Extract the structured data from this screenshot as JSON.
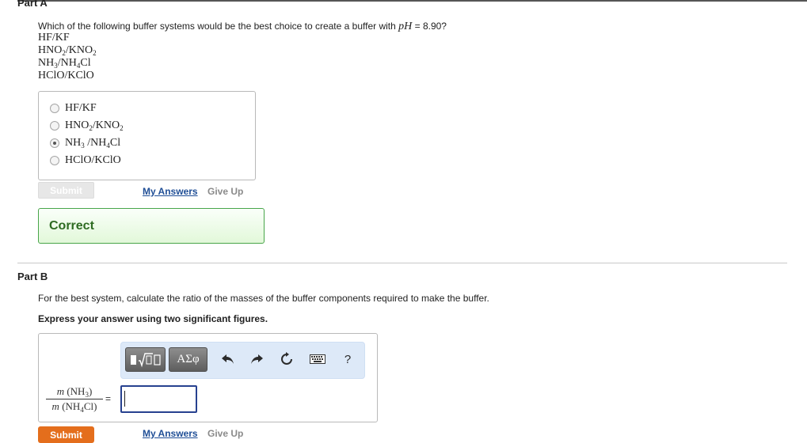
{
  "part_a": {
    "title": "Part A",
    "question_prefix": "Which of the following buffer systems would be the best choice to create a buffer with ",
    "question_ph": "pH",
    "question_suffix": " = 8.90?",
    "formulas": [
      {
        "a": "HF",
        "b": "KF"
      },
      {
        "a": "HNO",
        "a_sub": "2",
        "b": "KNO",
        "b_sub": "2"
      },
      {
        "a": "NH",
        "a_sub": "3",
        "b": "NH",
        "b_sub": "4",
        "b_tail": "Cl"
      },
      {
        "a": "HClO",
        "b": "KClO"
      }
    ],
    "choices": [
      {
        "id": "hf-kf",
        "selected": false
      },
      {
        "id": "hno2-kno2",
        "selected": false
      },
      {
        "id": "nh3-nh4cl",
        "selected": true
      },
      {
        "id": "hclo-kclo",
        "selected": false
      }
    ],
    "submit_label": "Submit",
    "my_answers_label": "My Answers",
    "give_up_label": "Give Up",
    "feedback": "Correct"
  },
  "part_b": {
    "title": "Part B",
    "question": "For the best system, calculate the ratio of the masses of the buffer components required to make the buffer.",
    "instruction": "Express your answer using two significant figures.",
    "toolbar": {
      "templates_icon": "templates-icon",
      "greek_label": "ΑΣφ",
      "undo_icon": "undo-icon",
      "redo_icon": "redo-icon",
      "reset_icon": "reset-icon",
      "keyboard_icon": "keyboard-icon",
      "help_label": "?"
    },
    "fraction_numerator_m": "m",
    "fraction_numerator_formula": "NH",
    "fraction_numerator_sub": "3",
    "fraction_denominator_m": "m",
    "fraction_denominator_formula": "NH",
    "fraction_denominator_sub": "4",
    "fraction_denominator_tail": "Cl",
    "equals": "=",
    "answer_value": "",
    "submit_label": "Submit",
    "my_answers_label": "My Answers",
    "give_up_label": "Give Up"
  },
  "colors": {
    "correct_border": "#48a54a",
    "correct_text": "#2e6b22",
    "submit_orange": "#e46e1c",
    "link_blue": "#1f4e96",
    "input_border": "#27418f"
  }
}
